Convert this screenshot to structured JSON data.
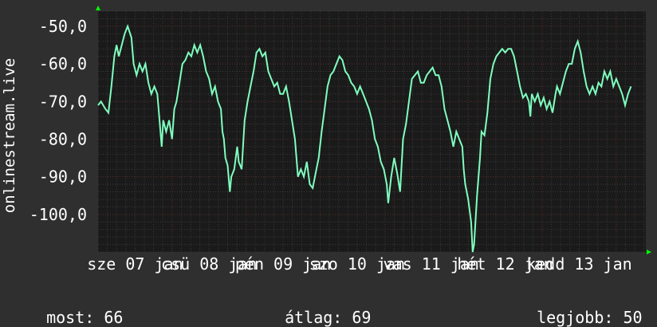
{
  "chart_data": {
    "type": "line",
    "ylabel": "onlinestream.live",
    "ylim": [
      -110,
      -46
    ],
    "yticks": [
      -100,
      -90,
      -80,
      -70,
      -60,
      -50
    ],
    "ytick_labels": [
      "-100,0",
      "-90,0",
      "-80,0",
      "-70,0",
      "-60,0",
      "-50,0"
    ],
    "xticks": [
      {
        "label": "sze 07 jan",
        "x": 0.5
      },
      {
        "label": "csü 08 jan",
        "x": 1.5
      },
      {
        "label": "pén 09 jan",
        "x": 2.5
      },
      {
        "label": "szo 10 jan",
        "x": 3.5
      },
      {
        "label": "vas 11 jan",
        "x": 4.5
      },
      {
        "label": "hét 12 jan",
        "x": 5.5
      },
      {
        "label": "kedd 13 jan",
        "x": 6.5
      }
    ],
    "xlim": [
      0,
      7.4
    ],
    "grid": true,
    "colors": {
      "line": "#7fffbf",
      "background": "#1a1a1a",
      "grid_minor": "#3a3a3a",
      "grid_major": "#5a2a2a",
      "axis_arrow": "#00ff00"
    },
    "series": [
      {
        "values": [
          [
            0.0,
            -71
          ],
          [
            0.04,
            -70
          ],
          [
            0.1,
            -72
          ],
          [
            0.14,
            -73
          ],
          [
            0.18,
            -66
          ],
          [
            0.22,
            -58
          ],
          [
            0.25,
            -55
          ],
          [
            0.28,
            -58
          ],
          [
            0.32,
            -55
          ],
          [
            0.36,
            -52
          ],
          [
            0.4,
            -50
          ],
          [
            0.45,
            -53
          ],
          [
            0.48,
            -60
          ],
          [
            0.52,
            -63
          ],
          [
            0.56,
            -60
          ],
          [
            0.6,
            -62
          ],
          [
            0.64,
            -60
          ],
          [
            0.68,
            -65
          ],
          [
            0.72,
            -68
          ],
          [
            0.76,
            -66
          ],
          [
            0.8,
            -68
          ],
          [
            0.83,
            -75
          ],
          [
            0.86,
            -82
          ],
          [
            0.88,
            -75
          ],
          [
            0.92,
            -78
          ],
          [
            0.96,
            -75
          ],
          [
            1.0,
            -80
          ],
          [
            1.03,
            -72
          ],
          [
            1.06,
            -70
          ],
          [
            1.1,
            -65
          ],
          [
            1.14,
            -60
          ],
          [
            1.18,
            -59
          ],
          [
            1.22,
            -57
          ],
          [
            1.26,
            -58
          ],
          [
            1.3,
            -55
          ],
          [
            1.34,
            -57
          ],
          [
            1.38,
            -55
          ],
          [
            1.42,
            -58
          ],
          [
            1.46,
            -62
          ],
          [
            1.5,
            -64
          ],
          [
            1.54,
            -68
          ],
          [
            1.58,
            -66
          ],
          [
            1.62,
            -70
          ],
          [
            1.66,
            -72
          ],
          [
            1.68,
            -78
          ],
          [
            1.7,
            -80
          ],
          [
            1.72,
            -85
          ],
          [
            1.75,
            -87
          ],
          [
            1.78,
            -94
          ],
          [
            1.8,
            -90
          ],
          [
            1.84,
            -88
          ],
          [
            1.88,
            -82
          ],
          [
            1.9,
            -86
          ],
          [
            1.94,
            -88
          ],
          [
            1.98,
            -75
          ],
          [
            2.02,
            -70
          ],
          [
            2.06,
            -66
          ],
          [
            2.1,
            -62
          ],
          [
            2.14,
            -57
          ],
          [
            2.18,
            -56
          ],
          [
            2.22,
            -58
          ],
          [
            2.26,
            -57
          ],
          [
            2.3,
            -62
          ],
          [
            2.34,
            -64
          ],
          [
            2.38,
            -66
          ],
          [
            2.42,
            -65
          ],
          [
            2.46,
            -68
          ],
          [
            2.5,
            -68
          ],
          [
            2.54,
            -66
          ],
          [
            2.58,
            -70
          ],
          [
            2.62,
            -75
          ],
          [
            2.66,
            -80
          ],
          [
            2.68,
            -85
          ],
          [
            2.7,
            -90
          ],
          [
            2.74,
            -88
          ],
          [
            2.78,
            -90
          ],
          [
            2.82,
            -86
          ],
          [
            2.86,
            -92
          ],
          [
            2.9,
            -93
          ],
          [
            2.94,
            -89
          ],
          [
            2.98,
            -85
          ],
          [
            3.02,
            -78
          ],
          [
            3.06,
            -72
          ],
          [
            3.1,
            -66
          ],
          [
            3.14,
            -63
          ],
          [
            3.18,
            -62
          ],
          [
            3.22,
            -60
          ],
          [
            3.26,
            -58
          ],
          [
            3.3,
            -59
          ],
          [
            3.34,
            -62
          ],
          [
            3.38,
            -63
          ],
          [
            3.42,
            -65
          ],
          [
            3.46,
            -66
          ],
          [
            3.5,
            -68
          ],
          [
            3.54,
            -66
          ],
          [
            3.58,
            -68
          ],
          [
            3.62,
            -70
          ],
          [
            3.66,
            -72
          ],
          [
            3.7,
            -75
          ],
          [
            3.74,
            -80
          ],
          [
            3.78,
            -82
          ],
          [
            3.82,
            -86
          ],
          [
            3.86,
            -88
          ],
          [
            3.9,
            -92
          ],
          [
            3.92,
            -97
          ],
          [
            3.96,
            -90
          ],
          [
            4.0,
            -85
          ],
          [
            4.04,
            -89
          ],
          [
            4.08,
            -94
          ],
          [
            4.12,
            -80
          ],
          [
            4.16,
            -76
          ],
          [
            4.2,
            -70
          ],
          [
            4.24,
            -64
          ],
          [
            4.28,
            -63
          ],
          [
            4.32,
            -62
          ],
          [
            4.36,
            -65
          ],
          [
            4.4,
            -65
          ],
          [
            4.44,
            -63
          ],
          [
            4.48,
            -62
          ],
          [
            4.52,
            -61
          ],
          [
            4.56,
            -63
          ],
          [
            4.6,
            -63
          ],
          [
            4.64,
            -66
          ],
          [
            4.68,
            -72
          ],
          [
            4.72,
            -75
          ],
          [
            4.76,
            -78
          ],
          [
            4.8,
            -82
          ],
          [
            4.84,
            -78
          ],
          [
            4.88,
            -80
          ],
          [
            4.92,
            -82
          ],
          [
            4.94,
            -88
          ],
          [
            4.96,
            -92
          ],
          [
            5.0,
            -96
          ],
          [
            5.04,
            -102
          ],
          [
            5.06,
            -110
          ],
          [
            5.08,
            -108
          ],
          [
            5.12,
            -95
          ],
          [
            5.16,
            -85
          ],
          [
            5.18,
            -78
          ],
          [
            5.22,
            -79
          ],
          [
            5.26,
            -73
          ],
          [
            5.3,
            -64
          ],
          [
            5.34,
            -60
          ],
          [
            5.38,
            -58
          ],
          [
            5.42,
            -57
          ],
          [
            5.46,
            -56
          ],
          [
            5.5,
            -57
          ],
          [
            5.54,
            -56
          ],
          [
            5.58,
            -56
          ],
          [
            5.62,
            -58
          ],
          [
            5.66,
            -62
          ],
          [
            5.7,
            -66
          ],
          [
            5.74,
            -69
          ],
          [
            5.78,
            -68
          ],
          [
            5.82,
            -70
          ],
          [
            5.84,
            -74
          ],
          [
            5.86,
            -68
          ],
          [
            5.9,
            -70
          ],
          [
            5.94,
            -68
          ],
          [
            5.98,
            -71
          ],
          [
            6.02,
            -69
          ],
          [
            6.06,
            -72
          ],
          [
            6.1,
            -70
          ],
          [
            6.14,
            -73
          ],
          [
            6.18,
            -68
          ],
          [
            6.2,
            -66
          ],
          [
            6.24,
            -68
          ],
          [
            6.28,
            -65
          ],
          [
            6.32,
            -62
          ],
          [
            6.36,
            -60
          ],
          [
            6.4,
            -60
          ],
          [
            6.44,
            -56
          ],
          [
            6.48,
            -54
          ],
          [
            6.52,
            -57
          ],
          [
            6.56,
            -62
          ],
          [
            6.6,
            -66
          ],
          [
            6.64,
            -68
          ],
          [
            6.68,
            -66
          ],
          [
            6.72,
            -68
          ],
          [
            6.76,
            -65
          ],
          [
            6.8,
            -66
          ],
          [
            6.84,
            -62
          ],
          [
            6.88,
            -64
          ],
          [
            6.92,
            -62
          ],
          [
            6.96,
            -66
          ],
          [
            7.0,
            -64
          ],
          [
            7.04,
            -66
          ],
          [
            7.08,
            -68
          ],
          [
            7.12,
            -71
          ],
          [
            7.16,
            -68
          ],
          [
            7.2,
            -66
          ]
        ]
      }
    ]
  },
  "footer": {
    "now_label": "most:",
    "now_value": "66",
    "avg_label": "átlag:",
    "avg_value": "69",
    "best_label": "legjobb:",
    "best_value": "50"
  }
}
